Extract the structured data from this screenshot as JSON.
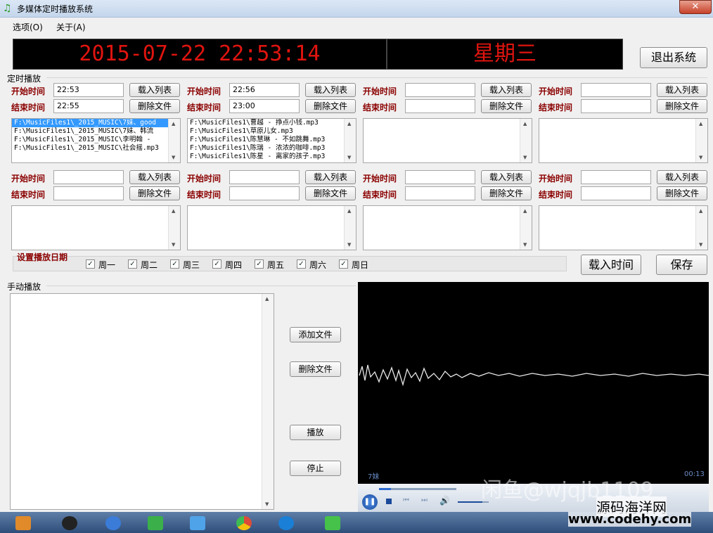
{
  "window": {
    "title": "多媒体定时播放系统",
    "close_label": "✕"
  },
  "menu": {
    "items": [
      {
        "label": "选项(O)"
      },
      {
        "label": "关于(A)"
      }
    ]
  },
  "clock": {
    "datetime": "2015-07-22 22:53:14",
    "weekday": "星期三"
  },
  "exit_button": "退出系统",
  "scheduled": {
    "group_label": "定时播放",
    "start_label": "开始时间",
    "end_label": "结束时间",
    "load_list_label": "载入列表",
    "delete_file_label": "删除文件",
    "slots": [
      {
        "start": "22:53",
        "end": "22:55",
        "files": [
          "F:\\MusicFiles1\\_2015_MUSIC\\7妹、good",
          "F:\\MusicFiles1\\_2015_MUSIC\\7妹、韩流",
          "F:\\MusicFiles1\\_2015_MUSIC\\李明翰 - ",
          "F:\\MusicFiles1\\_2015_MUSIC\\社会摇.mp3"
        ]
      },
      {
        "start": "22:56",
        "end": "23:00",
        "files": [
          "F:\\MusicFiles1\\曹越 - 挣点小钱.mp3",
          "F:\\MusicFiles1\\草原儿女.mp3",
          "F:\\MusicFiles1\\陈慧琳 - 不如跳舞.mp3",
          "F:\\MusicFiles1\\陈瑞 - 浓浓的咖啡.mp3",
          "F:\\MusicFiles1\\陈星 - 离家的孩子.mp3"
        ]
      },
      {
        "start": "",
        "end": "",
        "files": []
      },
      {
        "start": "",
        "end": "",
        "files": []
      },
      {
        "start": "",
        "end": "",
        "files": []
      },
      {
        "start": "",
        "end": "",
        "files": []
      },
      {
        "start": "",
        "end": "",
        "files": []
      },
      {
        "start": "",
        "end": "",
        "files": []
      }
    ]
  },
  "play_days": {
    "label": "设置播放日期",
    "days": [
      {
        "label": "周一",
        "checked": true
      },
      {
        "label": "周二",
        "checked": true
      },
      {
        "label": "周三",
        "checked": true
      },
      {
        "label": "周四",
        "checked": true
      },
      {
        "label": "周五",
        "checked": true
      },
      {
        "label": "周六",
        "checked": true
      },
      {
        "label": "周日",
        "checked": true
      }
    ],
    "load_time_label": "载入时间",
    "save_label": "保存"
  },
  "manual": {
    "group_label": "手动播放",
    "add_file_label": "添加文件",
    "delete_file_label": "删除文件",
    "play_label": "播放",
    "stop_label": "停止"
  },
  "player": {
    "track": "7妹",
    "time": "00:13",
    "progress": 0.15,
    "volume": 0.8
  },
  "watermarks": {
    "line1": "闲鱼@wjqjb1109",
    "line2": "源码海洋网",
    "line3": "www.codehy.com"
  }
}
